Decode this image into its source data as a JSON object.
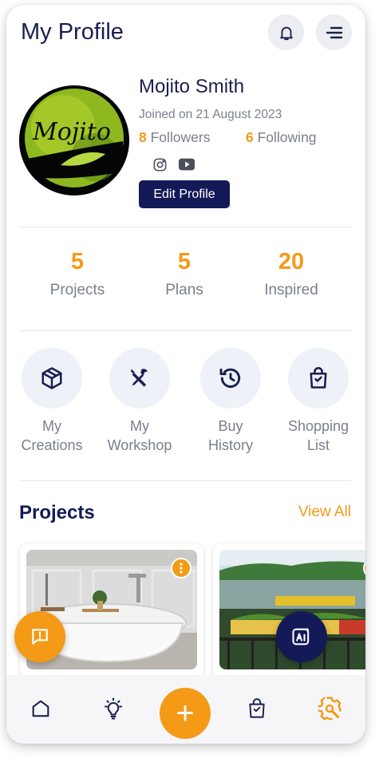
{
  "header": {
    "title": "My Profile",
    "notification_icon": "bell-icon",
    "menu_icon": "menu-icon"
  },
  "profile": {
    "name": "Mojito Smith",
    "joined": "Joined on 21 August 2023",
    "followers_count": "8",
    "followers_label": "Followers",
    "following_count": "6",
    "following_label": "Following",
    "avatar_text": "Mojito",
    "social": [
      "instagram-icon",
      "youtube-icon"
    ],
    "edit_label": "Edit Profile"
  },
  "stats": [
    {
      "value": "5",
      "label": "Projects"
    },
    {
      "value": "5",
      "label": "Plans"
    },
    {
      "value": "20",
      "label": "Inspired"
    }
  ],
  "quick_actions": [
    {
      "line1": "My",
      "line2": "Creations",
      "icon": "box-icon"
    },
    {
      "line1": "My",
      "line2": "Workshop",
      "icon": "tools-icon"
    },
    {
      "line1": "Buy",
      "line2": "History",
      "icon": "history-icon"
    },
    {
      "line1": "Shopping",
      "line2": "List",
      "icon": "shopping-bag-icon"
    }
  ],
  "projects": {
    "title": "Projects",
    "view_all": "View All"
  },
  "colors": {
    "accent": "#f49a17",
    "navy": "#141a57",
    "text_muted": "#7a7f8e"
  },
  "bottom_nav": [
    "home-icon",
    "lightbulb-icon",
    "plus-icon",
    "bag-icon",
    "settings-icon"
  ],
  "fab": {
    "chat_icon": "chat-icon",
    "ai_icon": "ai-icon",
    "add_label": "+"
  }
}
